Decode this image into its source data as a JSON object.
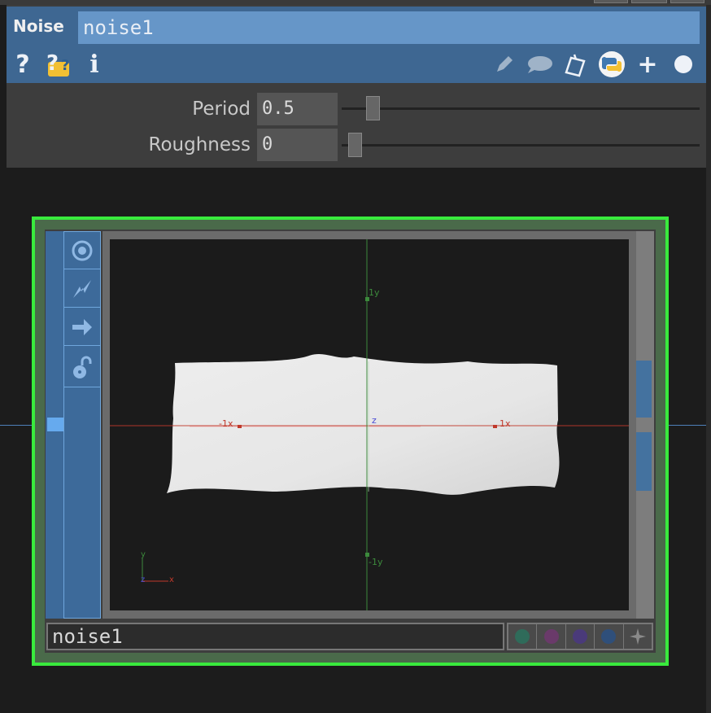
{
  "header": {
    "op_type": "Noise",
    "op_name": "noise1",
    "icons_left": [
      "help-icon",
      "python-help-icon",
      "info-icon"
    ],
    "icons_right": [
      "edit-icon",
      "comment-icon",
      "clone-icon",
      "python-icon",
      "add-icon",
      "dot-icon"
    ]
  },
  "params": [
    {
      "label": "Period",
      "value": "0.5",
      "slider": 0.07
    },
    {
      "label": "Roughness",
      "value": "0",
      "slider": 0.02
    }
  ],
  "node": {
    "name": "noise1",
    "side_buttons": [
      "viewer-icon",
      "bypass-icon",
      "export-icon",
      "lock-icon"
    ],
    "flag_colors": [
      "#2f6b5a",
      "#6a3a6a",
      "#4a3a7a",
      "#2f4f7a"
    ],
    "outline_color": "#39ea3d"
  },
  "viewport": {
    "axis_labels": {
      "pos_y": "1y",
      "neg_y": "-1y",
      "pos_x": "1x",
      "neg_x": "-1x",
      "z": "z"
    },
    "gizmo": {
      "x": "x",
      "y": "y",
      "z": "z"
    },
    "x_axis_color": "#c0392b",
    "y_axis_color": "#3c8a3c",
    "z_axis_color": "#4b4bd6"
  }
}
